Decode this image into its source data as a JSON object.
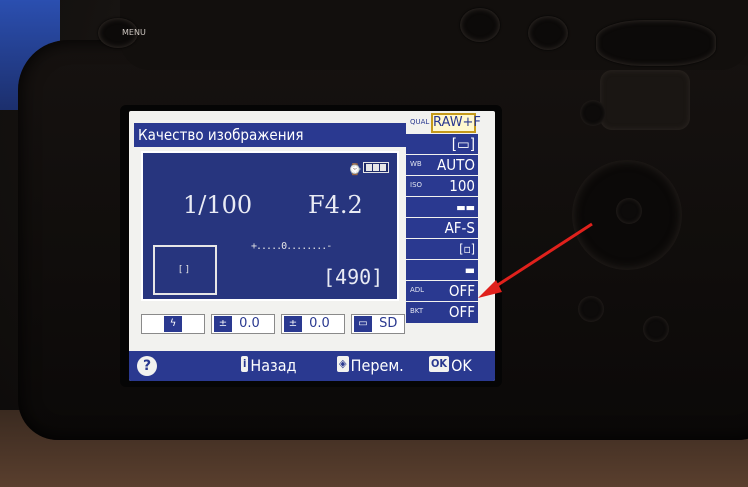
{
  "camera": {
    "menu_button_label": "MENU"
  },
  "screen": {
    "title": "Качество изображения",
    "shooting_info": {
      "shutter_speed": "1/100",
      "aperture": "F4.2",
      "shots_remaining": "[490]",
      "exposure_meter": "+.....0........-",
      "af_point_glyph": "[ ]",
      "battery_icon": "battery-icon"
    },
    "bottom_settings": [
      {
        "name": "flash-mode",
        "icon": "flash-icon",
        "icon_glyph": "ϟ",
        "value": ""
      },
      {
        "name": "flash-compensation",
        "icon": "flash-comp-icon",
        "icon_glyph": "±",
        "value": "0.0"
      },
      {
        "name": "exposure-compensation",
        "icon": "exposure-comp-icon",
        "icon_glyph": "±",
        "value": "0.0"
      },
      {
        "name": "picture-control",
        "icon": "picture-control-icon",
        "icon_glyph": "▭",
        "value": "SD"
      }
    ],
    "side_settings": [
      {
        "label": "QUAL",
        "value": "RAW+F",
        "selected": true
      },
      {
        "label": "",
        "value": "[▭]"
      },
      {
        "label": "WB",
        "value": "AUTO"
      },
      {
        "label": "ISO",
        "value": "100"
      },
      {
        "label": "",
        "value": "▬▬"
      },
      {
        "label": "",
        "value": "AF-S"
      },
      {
        "label": "",
        "value": "[▫]"
      },
      {
        "label": "",
        "value": "▬"
      },
      {
        "label": "ADL",
        "value": "OFF"
      },
      {
        "label": "BKT",
        "value": "OFF"
      }
    ],
    "help_bar": {
      "help_glyph": "?",
      "back_key": "i",
      "back_label": "Назад",
      "change_key": "◈",
      "change_label": "Перем.",
      "ok_key": "OK",
      "ok_label": "OK"
    }
  },
  "annotation": {
    "arrow_color": "#e0211c"
  }
}
